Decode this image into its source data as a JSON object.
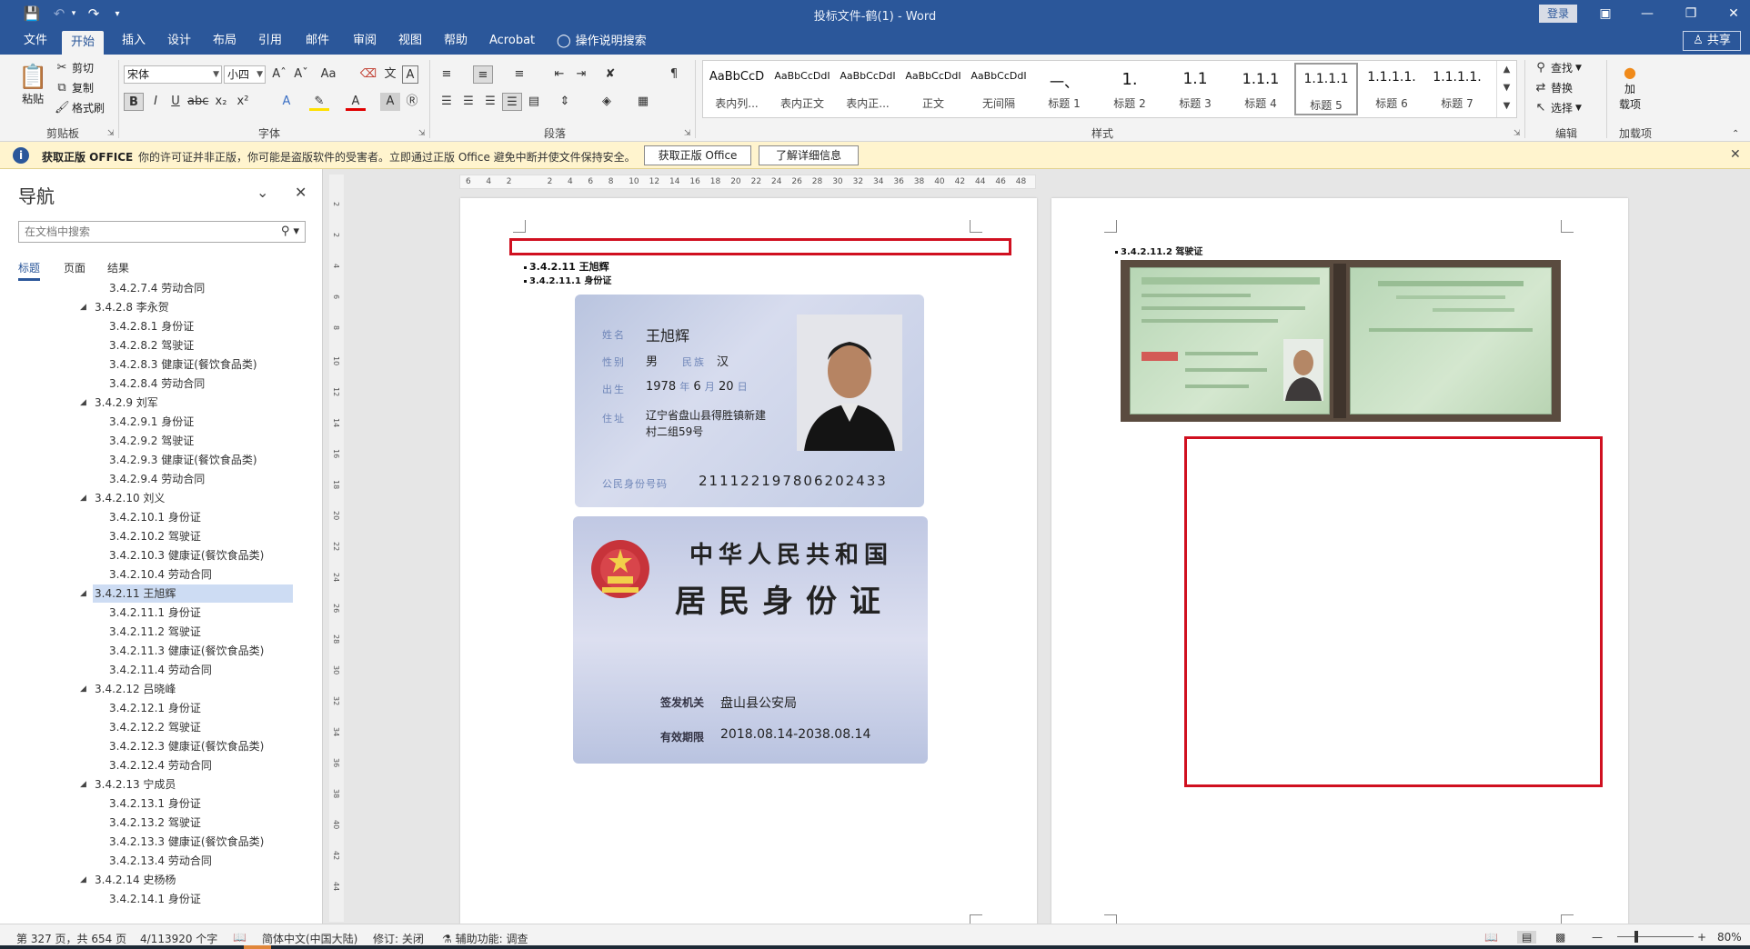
{
  "titlebar": {
    "doc_title": "投标文件-鹤(1) - Word",
    "login": "登录",
    "save_icon": "save-icon",
    "undo_icon": "undo-icon",
    "redo_icon": "redo-icon"
  },
  "tabs": [
    {
      "label": "文件",
      "active": false
    },
    {
      "label": "开始",
      "active": true
    },
    {
      "label": "插入",
      "active": false
    },
    {
      "label": "设计",
      "active": false
    },
    {
      "label": "布局",
      "active": false
    },
    {
      "label": "引用",
      "active": false
    },
    {
      "label": "邮件",
      "active": false
    },
    {
      "label": "审阅",
      "active": false
    },
    {
      "label": "视图",
      "active": false
    },
    {
      "label": "帮助",
      "active": false
    },
    {
      "label": "Acrobat",
      "active": false
    },
    {
      "label": "操作说明搜索",
      "active": false
    }
  ],
  "share_label": "共享",
  "ribbon": {
    "clipboard": {
      "paste": "粘贴",
      "cut": "剪切",
      "copy": "复制",
      "format_painter": "格式刷",
      "label": "剪贴板"
    },
    "font": {
      "name": "宋体",
      "size": "小四",
      "label": "字体"
    },
    "paragraph": {
      "label": "段落"
    },
    "styles": {
      "label": "样式",
      "items": [
        {
          "preview": "AaBbCcD",
          "name": "表内列..."
        },
        {
          "preview": "AaBbCcDdI",
          "name": "表内正文"
        },
        {
          "preview": "AaBbCcDdI",
          "name": "表内正..."
        },
        {
          "preview": "AaBbCcDdI",
          "name": "正文"
        },
        {
          "preview": "AaBbCcDdI",
          "name": "无间隔"
        },
        {
          "preview": "一、",
          "name": "标题 1"
        },
        {
          "preview": "1.",
          "name": "标题 2"
        },
        {
          "preview": "1.1",
          "name": "标题 3"
        },
        {
          "preview": "1.1.1",
          "name": "标题 4"
        },
        {
          "preview": "1.1.1.1",
          "name": "标题 5",
          "selected": true
        },
        {
          "preview": "1.1.1.1.",
          "name": "标题 6"
        },
        {
          "preview": "1.1.1.1.",
          "name": "标题 7"
        }
      ]
    },
    "editing": {
      "find": "查找",
      "replace": "替换",
      "select": "选择",
      "label": "编辑"
    },
    "addins": {
      "top": "加",
      "mid": "载项",
      "label": "加载项"
    }
  },
  "message_bar": {
    "title": "获取正版 OFFICE",
    "text": "你的许可证并非正版，你可能是盗版软件的受害者。立即通过正版 Office 避免中断并使文件保持安全。",
    "btn_get": "获取正版 Office",
    "btn_more": "了解详细信息"
  },
  "nav": {
    "title": "导航",
    "search_placeholder": "在文档中搜索",
    "tabs": [
      "标题",
      "页面",
      "结果"
    ],
    "items": [
      {
        "text": "3.4.2.7.4 劳动合同",
        "level": 2
      },
      {
        "text": "3.4.2.8 李永贺",
        "level": 1
      },
      {
        "text": "3.4.2.8.1 身份证",
        "level": 2
      },
      {
        "text": "3.4.2.8.2 驾驶证",
        "level": 2
      },
      {
        "text": "3.4.2.8.3 健康证(餐饮食品类)",
        "level": 2
      },
      {
        "text": "3.4.2.8.4 劳动合同",
        "level": 2
      },
      {
        "text": "3.4.2.9 刘军",
        "level": 1
      },
      {
        "text": "3.4.2.9.1 身份证",
        "level": 2
      },
      {
        "text": "3.4.2.9.2 驾驶证",
        "level": 2
      },
      {
        "text": "3.4.2.9.3 健康证(餐饮食品类)",
        "level": 2
      },
      {
        "text": "3.4.2.9.4 劳动合同",
        "level": 2
      },
      {
        "text": "3.4.2.10 刘义",
        "level": 1
      },
      {
        "text": "3.4.2.10.1 身份证",
        "level": 2
      },
      {
        "text": "3.4.2.10.2 驾驶证",
        "level": 2
      },
      {
        "text": "3.4.2.10.3 健康证(餐饮食品类)",
        "level": 2
      },
      {
        "text": "3.4.2.10.4 劳动合同",
        "level": 2
      },
      {
        "text": "3.4.2.11 王旭辉",
        "level": 1,
        "selected": true
      },
      {
        "text": "3.4.2.11.1 身份证",
        "level": 2
      },
      {
        "text": "3.4.2.11.2 驾驶证",
        "level": 2
      },
      {
        "text": "3.4.2.11.3 健康证(餐饮食品类)",
        "level": 2
      },
      {
        "text": "3.4.2.11.4 劳动合同",
        "level": 2
      },
      {
        "text": "3.4.2.12 吕晓峰",
        "level": 1
      },
      {
        "text": "3.4.2.12.1 身份证",
        "level": 2
      },
      {
        "text": "3.4.2.12.2 驾驶证",
        "level": 2
      },
      {
        "text": "3.4.2.12.3 健康证(餐饮食品类)",
        "level": 2
      },
      {
        "text": "3.4.2.12.4 劳动合同",
        "level": 2
      },
      {
        "text": "3.4.2.13 宁成员",
        "level": 1
      },
      {
        "text": "3.4.2.13.1 身份证",
        "level": 2
      },
      {
        "text": "3.4.2.13.2 驾驶证",
        "level": 2
      },
      {
        "text": "3.4.2.13.3 健康证(餐饮食品类)",
        "level": 2
      },
      {
        "text": "3.4.2.13.4 劳动合同",
        "level": 2
      },
      {
        "text": "3.4.2.14 史杨杨",
        "level": 1
      },
      {
        "text": "3.4.2.14.1 身份证",
        "level": 2
      }
    ]
  },
  "hruler_ticks": [
    "6",
    "4",
    "2",
    "",
    "2",
    "4",
    "6",
    "8",
    "10",
    "12",
    "14",
    "16",
    "18",
    "20",
    "22",
    "24",
    "26",
    "28",
    "30",
    "32",
    "34",
    "36",
    "38",
    "40",
    "42",
    "44",
    "46",
    "48"
  ],
  "vruler_ticks": [
    "2",
    "2",
    "4",
    "6",
    "8",
    "10",
    "12",
    "14",
    "16",
    "18",
    "20",
    "22",
    "24",
    "26",
    "28",
    "30",
    "32",
    "34",
    "36",
    "38",
    "40",
    "42",
    "44"
  ],
  "page1": {
    "heading1": "3.4.2.11 王旭辉",
    "heading2": "3.4.2.11.1 身份证",
    "idcard_front": {
      "name_label": "姓名",
      "name": "王旭辉",
      "sex_label": "性别",
      "sex": "男",
      "ethnic_label": "民族",
      "ethnic": "汉",
      "birth_label": "出生",
      "birth_year": "1978",
      "year": "年",
      "birth_month": "6",
      "month": "月",
      "birth_day": "20",
      "day": "日",
      "addr_label": "住址",
      "addr1": "辽宁省盘山县得胜镇新建",
      "addr2": "村二组59号",
      "idno_label": "公民身份号码",
      "idno": "211122197806202433"
    },
    "idcard_back": {
      "title1": "中华人民共和国",
      "title2": "居民身份证",
      "authority_label": "签发机关",
      "authority": "盘山县公安局",
      "validity_label": "有效期限",
      "validity": "2018.08.14-2038.08.14"
    }
  },
  "page2": {
    "heading": "3.4.2.11.2 驾驶证"
  },
  "status": {
    "page": "第 327 页，共 654 页",
    "words": "4/113920 个字",
    "lang": "简体中文(中国大陆)",
    "track": "修订: 关闭",
    "accessibility": "辅助功能: 调查",
    "zoom": "80%"
  }
}
